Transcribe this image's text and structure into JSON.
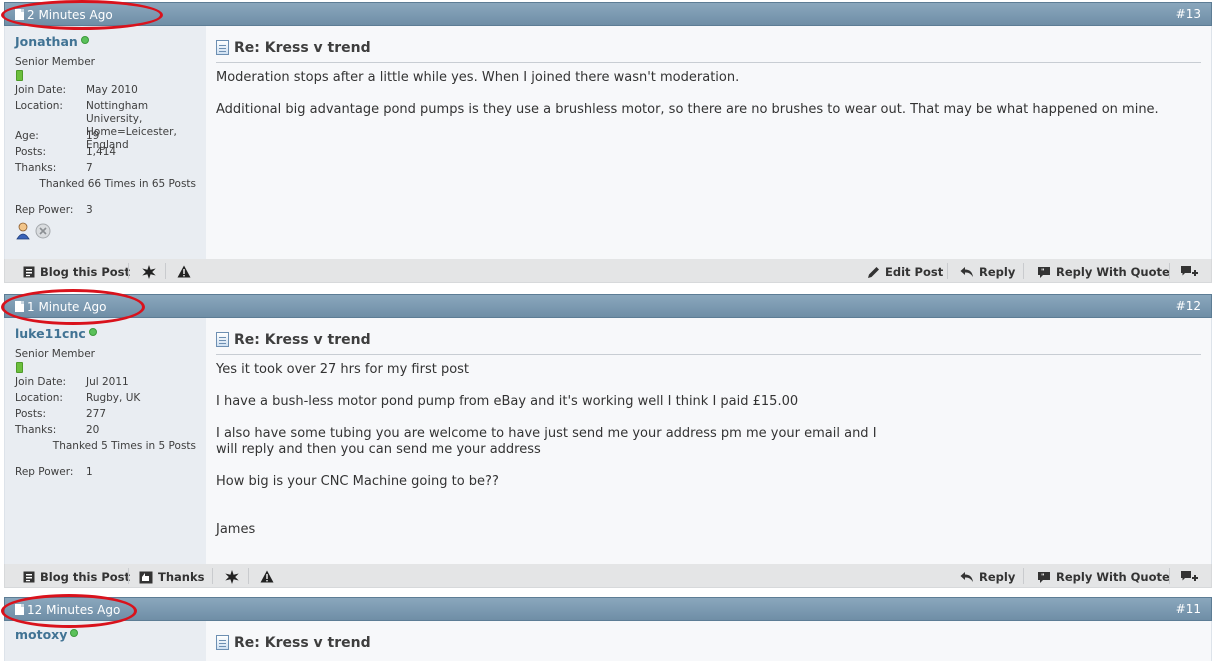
{
  "posts": [
    {
      "date": "2 Minutes Ago",
      "number": "#13",
      "user": {
        "name": "Jonathan",
        "title": "Senior Member",
        "fields": [
          {
            "label": "Join Date:",
            "value": "May 2010"
          },
          {
            "label": "Location:",
            "value": "Nottingham University, Home=Leicester, England"
          },
          {
            "label": "Age:",
            "value": "19"
          },
          {
            "label": "Posts:",
            "value": "1,414"
          },
          {
            "label": "Thanks:",
            "value": "7"
          }
        ],
        "thanked": "Thanked 66 Times in 65 Posts",
        "rep_label": "Rep Power:",
        "rep_value": "3"
      },
      "title": "Re: Kress v trend",
      "body": "Moderation stops after a little while yes. When I joined there wasn't moderation.\n\nAdditional big advantage pond pumps is they use a brushless motor, so there are no brushes to wear out. That may be what happened on mine.",
      "footer": {
        "blog": "Blog this Post",
        "edit": "Edit Post",
        "reply": "Reply",
        "reply_quote": "Reply With Quote"
      }
    },
    {
      "date": "1 Minute Ago",
      "number": "#12",
      "user": {
        "name": "luke11cnc",
        "title": "Senior Member",
        "fields": [
          {
            "label": "Join Date:",
            "value": "Jul 2011"
          },
          {
            "label": "Location:",
            "value": "Rugby, UK"
          },
          {
            "label": "Posts:",
            "value": "277"
          },
          {
            "label": "Thanks:",
            "value": "20"
          }
        ],
        "thanked": "Thanked 5 Times in 5 Posts",
        "rep_label": "Rep Power:",
        "rep_value": "1"
      },
      "title": "Re: Kress v trend",
      "body": "Yes it took over 27 hrs for my first post\n\nI have a bush-less motor pond pump from eBay and it's working well I think I paid £15.00\n\nI also have some tubing you are welcome to have just send me your address pm me your email and I\nwill reply and then you can send me your address\n\nHow big is your CNC Machine going to be??\n\n\nJames",
      "footer": {
        "blog": "Blog this Post",
        "thanks": "Thanks",
        "reply": "Reply",
        "reply_quote": "Reply With Quote"
      }
    },
    {
      "date": "12 Minutes Ago",
      "number": "#11",
      "user": {
        "name": "motoxy"
      },
      "title": "Re: Kress v trend"
    }
  ],
  "colors": {
    "header": "#7d9bb2",
    "username": "#417394",
    "annotation": "#d9121c"
  }
}
